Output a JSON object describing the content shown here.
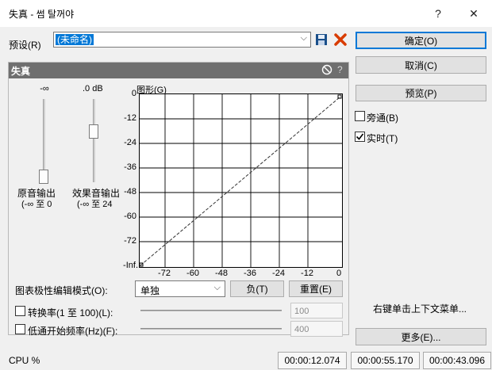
{
  "window": {
    "title": "失真 - 썸 탈꺼야",
    "help_label": "?",
    "close_label": "✕"
  },
  "preset": {
    "label": "预设(R)",
    "value": "(未命名)"
  },
  "buttons": {
    "ok": "确定(O)",
    "cancel": "取消(C)",
    "preview": "预览(P)",
    "more": "更多(E)..."
  },
  "checks": {
    "bypass": "旁通(B)",
    "realtime": "实时(T)",
    "bypass_checked": false,
    "realtime_checked": true
  },
  "effect_panel": {
    "title": "失真",
    "help_label": "?",
    "dry": {
      "top_value": "-∞",
      "label": "原音输出",
      "range": "(-∞ 至 0"
    },
    "wet": {
      "top_value": ".0 dB",
      "label": "效果音输出",
      "range": "(-∞ 至 24"
    },
    "graph": {
      "title": "图形(G)",
      "y_ticks": [
        "0",
        "-12",
        "-24",
        "-36",
        "-48",
        "-60",
        "-72",
        "-Inf."
      ],
      "x_ticks": [
        "-72",
        "-60",
        "-48",
        "-36",
        "-24",
        "-12",
        "0"
      ]
    },
    "polarity": {
      "label": "图表极性编辑模式(O):",
      "value": "单独",
      "negative_button": "负(T)",
      "reset_button": "重置(E)"
    },
    "slew": {
      "label": "转换率(1 至 100)(L):",
      "value": "100",
      "checked": false
    },
    "lowpass": {
      "label": "低通开始频率(Hz)(F):",
      "value": "400",
      "checked": false
    }
  },
  "hint": "右键单击上下文菜单...",
  "status": {
    "cpu": "CPU %",
    "time1": "00:00:12.074",
    "time2": "00:00:55.170",
    "time3": "00:00:43.096"
  },
  "colors": {
    "accent": "#0078d7",
    "delete_red": "#d83b01",
    "save_blue": "#1a4f8a",
    "panel_header": "#6f6f6f"
  },
  "icons": {
    "save": "save-icon",
    "delete": "delete-icon",
    "bypass": "bypass-circle-icon",
    "dropdown": "chevron-down-icon"
  }
}
